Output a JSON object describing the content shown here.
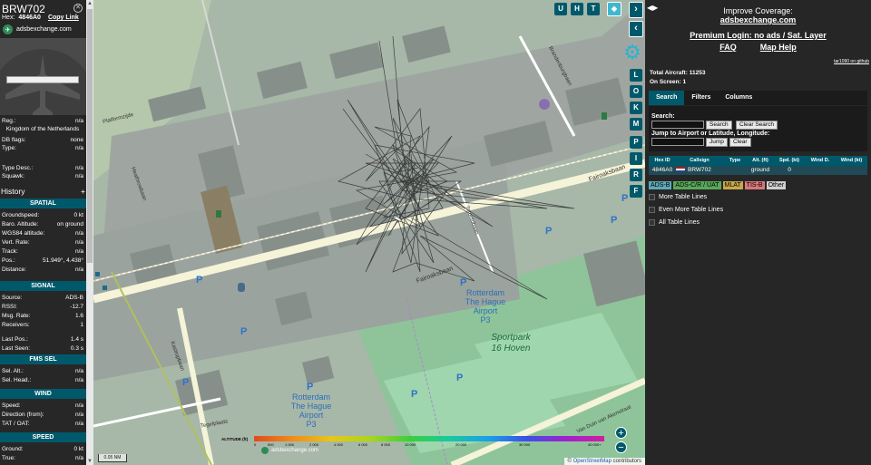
{
  "aircraft": {
    "callsign": "BRW702",
    "hex_label": "Hex:",
    "hex": "4846A0",
    "copy_link": "Copy Link",
    "site": "adsbexchange.com"
  },
  "details": {
    "reg_label": "Reg.:",
    "reg": "n/a",
    "country": "Kingdom of the Netherlands",
    "dbflags_label": "DB flags:",
    "dbflags": "none",
    "type_label": "Type:",
    "type": "n/a",
    "typedesc_label": "Type Desc.:",
    "typedesc": "n/a",
    "squawk_label": "Squawk:",
    "squawk": "n/a"
  },
  "history_label": "History",
  "history_plus": "+",
  "spatial": {
    "header": "SPATIAL",
    "rows": [
      {
        "k": "Groundspeed:",
        "v": "0 kt"
      },
      {
        "k": "Baro. Altitude:",
        "v": "on ground"
      },
      {
        "k": "WGS84 altitude:",
        "v": "n/a"
      },
      {
        "k": "Vert. Rate:",
        "v": "n/a"
      },
      {
        "k": "Track:",
        "v": "n/a"
      },
      {
        "k": "Pos.:",
        "v": "51.949°, 4.438°"
      },
      {
        "k": "Distance:",
        "v": "n/a"
      }
    ]
  },
  "signal": {
    "header": "SIGNAL",
    "rows": [
      {
        "k": "Source:",
        "v": "ADS-B"
      },
      {
        "k": "RSSI:",
        "v": "-12.7"
      },
      {
        "k": "Msg. Rate:",
        "v": "1.6"
      },
      {
        "k": "Receivers:",
        "v": "1"
      },
      {
        "k": "Last Pos.:",
        "v": "1.4 s"
      },
      {
        "k": "Last Seen:",
        "v": "0.3 s"
      }
    ]
  },
  "fmssel": {
    "header": "FMS SEL",
    "rows": [
      {
        "k": "Sel. Alt.:",
        "v": "n/a"
      },
      {
        "k": "Sel. Head.:",
        "v": "n/a"
      }
    ]
  },
  "wind": {
    "header": "WIND",
    "rows": [
      {
        "k": "Speed:",
        "v": "n/a"
      },
      {
        "k": "Direction (from):",
        "v": "n/a"
      },
      {
        "k": "TAT / OAT:",
        "v": "n/a"
      }
    ]
  },
  "speed": {
    "header": "SPEED",
    "rows": [
      {
        "k": "Ground:",
        "v": "0 kt"
      },
      {
        "k": "True:",
        "v": "n/a"
      }
    ]
  },
  "map": {
    "top_buttons": [
      "U",
      "H",
      "T"
    ],
    "side_buttons": [
      "L",
      "O",
      "K",
      "M",
      "P",
      "I",
      "R",
      "F"
    ],
    "labels": {
      "street1": "Fairoaksbaan",
      "street2": "Fairoaksbaan",
      "street3": "Heathrowbaan",
      "street4": "Kastrupbaan",
      "street5": "Tegelplaats",
      "street6": "Platformzijde",
      "street7": "Brandenburgbaan",
      "street8": "Torontobaan",
      "street9": "Vliegveld",
      "airport1": "Rotterdam",
      "airport2": "The Hague",
      "airport3": "Airport",
      "airport4": "P3",
      "sport1": "Sportpark",
      "sport2": "16 Hoven",
      "duin": "Van Duin van Akenstraat"
    },
    "parking": "P",
    "altitude_label": "ALTITUDE (ft)",
    "altitude_ticks": [
      "0",
      "500",
      "1 000",
      "2 000",
      "4 000",
      "6 000",
      "8 000",
      "10 000",
      "20 000",
      "30 000",
      "40 000+"
    ],
    "altitude_brand": "adsbexchange.com",
    "scale": "0.05 NM",
    "osm_prefix": "©",
    "osm_link": "OpenStreetMap",
    "osm_suffix": "contributors",
    "zoom_in": "+",
    "zoom_out": "−"
  },
  "right": {
    "improve": "Improve Coverage:",
    "site": "adsbexchange.com",
    "premium": "Premium Login: no ads / Sat. Layer",
    "faq": "FAQ",
    "maphelp": "Map Help",
    "github": "tar1090 on github",
    "total_label": "Total Aircraft:",
    "total": "11253",
    "onscreen_label": "On Screen:",
    "onscreen": "1",
    "tabs": [
      "Search",
      "Filters",
      "Columns"
    ],
    "search_label": "Search:",
    "search_btn": "Search",
    "clear_search_btn": "Clear Search",
    "jump_label": "Jump to Airport or Latitude, Longitude:",
    "jump_btn": "Jump",
    "clear_btn": "Clear",
    "table": {
      "headers": [
        "Hex ID",
        "Callsign",
        "Type",
        "Alt. (ft)",
        "Spd. (kt)",
        "Wind D.",
        "Wind (kt)"
      ],
      "row": {
        "hex": "4846A0",
        "callsign": "BRW702",
        "type": "",
        "alt": "ground",
        "spd": "0",
        "windd": "",
        "wind": ""
      }
    },
    "badges": [
      {
        "label": "ADS-B",
        "color": "#5fa8b8"
      },
      {
        "label": "ADS-C/R / UAT",
        "color": "#58a858"
      },
      {
        "label": "MLAT",
        "color": "#c8a84a"
      },
      {
        "label": "TIS-B",
        "color": "#d8787a"
      },
      {
        "label": "Other",
        "color": "#cfcfcf"
      }
    ],
    "checks": [
      "More Table Lines",
      "Even More Table Lines",
      "All Table Lines"
    ]
  }
}
